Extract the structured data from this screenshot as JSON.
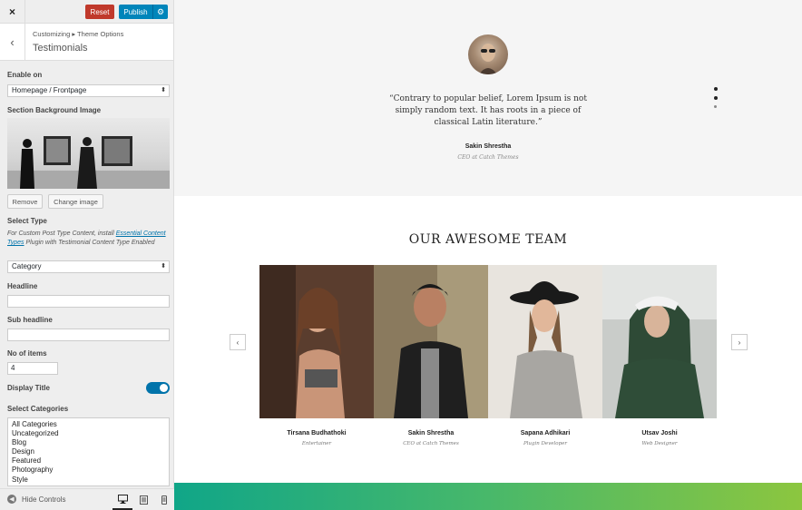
{
  "topbar": {
    "close_icon": "×",
    "reset_label": "Reset",
    "publish_label": "Publish",
    "gear_icon": "⚙",
    "reset_color": "#c0392b",
    "publish_color": "#0085ba"
  },
  "section": {
    "back_icon": "‹",
    "breadcrumb": "Customizing ▸ Theme Options",
    "title": "Testimonials"
  },
  "controls": {
    "enable_on": {
      "label": "Enable on",
      "value": "Homepage / Frontpage"
    },
    "bg_image": {
      "label": "Section Background Image",
      "remove_label": "Remove",
      "change_label": "Change image"
    },
    "select_type": {
      "label": "Select Type",
      "desc_prefix": "For Custom Post Type Content, install ",
      "desc_link": "Essential Content Types",
      "desc_suffix": " Plugin with Testimonial Content Type Enabled",
      "value": "Category"
    },
    "headline": {
      "label": "Headline",
      "value": ""
    },
    "sub_headline": {
      "label": "Sub headline",
      "value": ""
    },
    "no_of_items": {
      "label": "No of items",
      "value": "4"
    },
    "display_title": {
      "label": "Display Title",
      "enabled": true
    },
    "select_categories": {
      "label": "Select Categories",
      "options": [
        "All Categories",
        "Uncategorized",
        "Blog",
        "Design",
        "Featured",
        "Photography",
        "Style"
      ]
    }
  },
  "footer": {
    "hide_controls_label": "Hide Controls",
    "devices": [
      "desktop",
      "tablet",
      "mobile"
    ]
  },
  "preview": {
    "testimonial": {
      "quote": "“Contrary to popular belief, Lorem Ipsum is not simply random text. It has roots in a piece of classical Latin literature.”",
      "name": "Sakin Shrestha",
      "role": "CEO at Catch Themes"
    },
    "team": {
      "title": "OUR AWESOME TEAM",
      "prev_icon": "‹",
      "next_icon": "›",
      "members": [
        {
          "name": "Tirsana Budhathoki",
          "role": "Entertainer"
        },
        {
          "name": "Sakin Shrestha",
          "role": "CEO at Catch Themes"
        },
        {
          "name": "Sapana Adhikari",
          "role": "Plugin Developer"
        },
        {
          "name": "Utsav Joshi",
          "role": "Web Designer"
        }
      ]
    }
  }
}
